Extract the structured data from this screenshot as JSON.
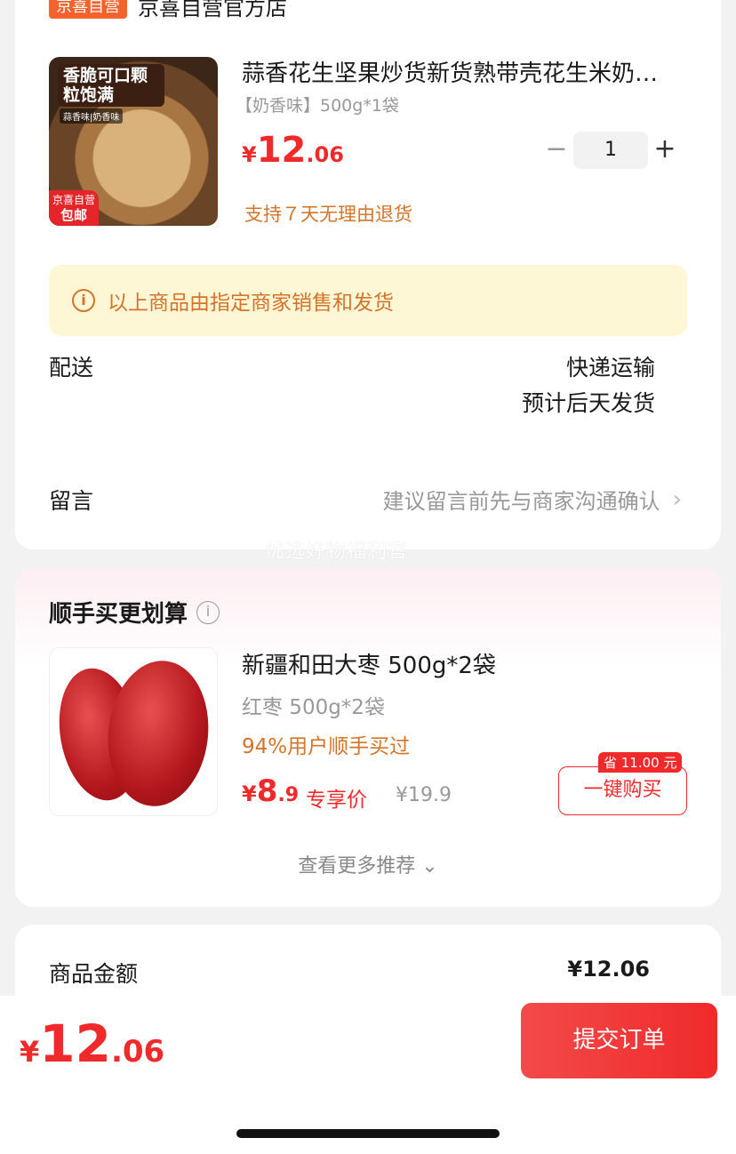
{
  "store": {
    "badge": "京喜自营",
    "name": "京喜自营官方店"
  },
  "product": {
    "image_overlay": {
      "title": "香脆可口颗粒饱满",
      "subtitle": "蒜香味|奶香味",
      "badge_line1": "京喜自营",
      "badge_line2": "包邮"
    },
    "title": "蒜香花生坚果炒货新货熟带壳花生米奶…",
    "spec": "【奶香味】500g*1袋",
    "price": {
      "symbol": "¥",
      "int": "12",
      "dec": ".06"
    },
    "return_policy": "支持７天无理由退货",
    "quantity": {
      "minus": "−",
      "value": "1",
      "plus": "+"
    }
  },
  "notice": {
    "icon": "ⓘ",
    "text": "以上商品由指定商家销售和发货"
  },
  "shipping": {
    "label": "配送",
    "method": "快递运输",
    "estimate": "预计后天发货"
  },
  "message": {
    "label": "留言",
    "placeholder": "建议留言前先与商家沟通确认",
    "chevron": "›"
  },
  "watermark": "优选好物福利官",
  "recommend": {
    "title": "顺手买更划算",
    "info_icon": "i",
    "item": {
      "title": "新疆和田大枣 500g*2袋",
      "spec": "红枣 500g*2袋",
      "popularity": "94%用户顺手买过",
      "price": {
        "symbol": "¥",
        "int": "8",
        "dec": ".9"
      },
      "price_tag": "专享价",
      "original_price": "¥19.9",
      "save_tag": "省 11.00 元",
      "buy_label": "一键购买"
    },
    "more_label": "查看更多推荐",
    "more_icon": "⌄"
  },
  "summary": {
    "label": "商品金额",
    "value": "¥12.06"
  },
  "bottom": {
    "total": {
      "symbol": "¥",
      "int": "12",
      "dec": ".06"
    },
    "submit_label": "提交订单"
  },
  "colors": {
    "accent": "#f02a2a",
    "orange": "#d4742b",
    "notice_bg": "#fdf7d5"
  }
}
